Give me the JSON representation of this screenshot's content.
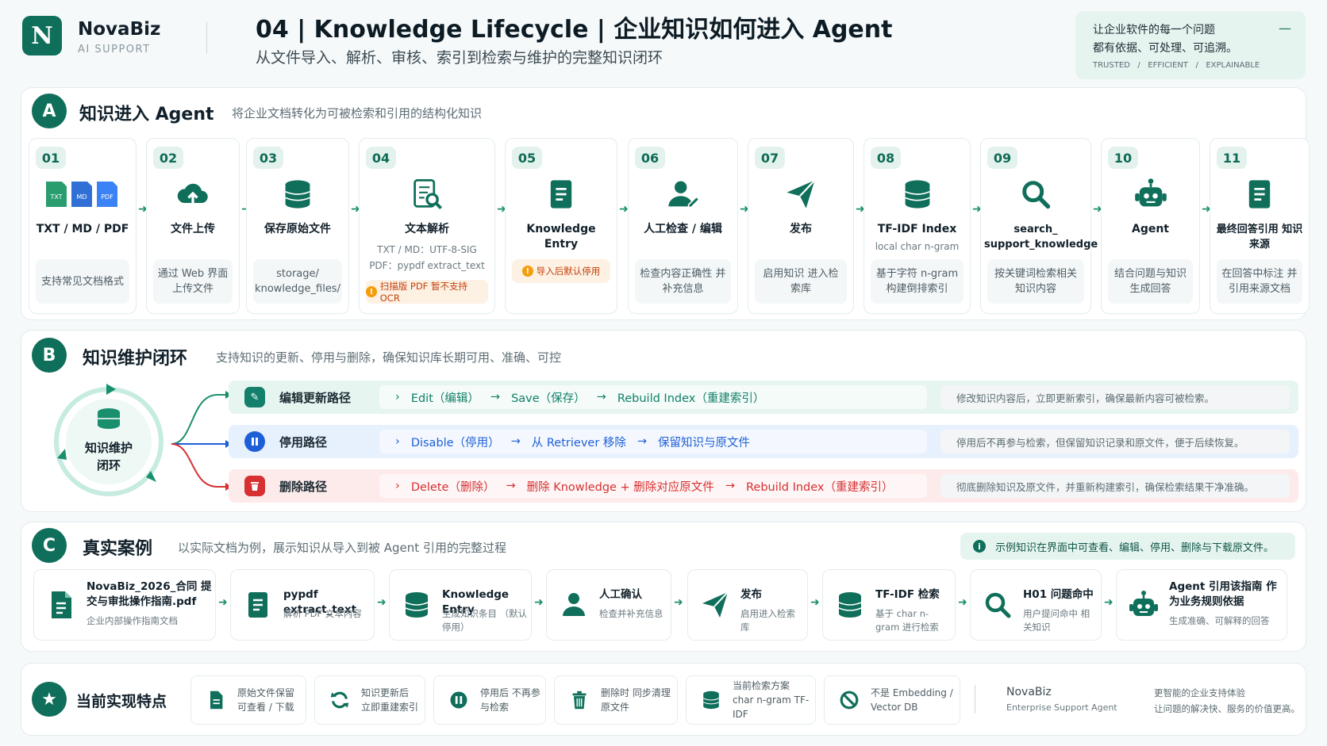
{
  "brand": {
    "logo_letter": "N",
    "name": "NovaBiz",
    "tag": "AI SUPPORT"
  },
  "header": {
    "title": "04 | Knowledge Lifecycle | 企业知识如何进入 Agent",
    "subtitle": "从文件导入、解析、审核、索引到检索与维护的完整知识闭环"
  },
  "motto": {
    "line1": "让企业软件的每一个问题",
    "line2": "都有依据、可处理、可追溯。",
    "tags": "TRUSTED   /   EFFICIENT   /   EXPLAINABLE",
    "dash": "—"
  },
  "sectionA": {
    "letter": "A",
    "title": "知识进入 Agent",
    "subtitle": "将企业文档转化为可被检索和引用的结构化知识",
    "steps": [
      {
        "num": "01",
        "title": "TXT / MD / PDF",
        "sub": "",
        "desc": "支持常见文档格式",
        "icon": "file-types-icon"
      },
      {
        "num": "02",
        "title": "文件上传",
        "sub": "",
        "desc": "通过 Web 界面上传文件",
        "icon": "cloud-upload-icon"
      },
      {
        "num": "03",
        "title": "保存原始文件",
        "sub": "",
        "desc": "storage/ knowledge_files/",
        "icon": "database-icon"
      },
      {
        "num": "04",
        "title": "文本解析",
        "sub": "TXT / MD：UTF-8-SIG",
        "sub2": "PDF：pypdf extract_text",
        "warn": "扫描版 PDF 暂不支持 OCR",
        "icon": "document-search-icon"
      },
      {
        "num": "05",
        "title": "Knowledge Entry",
        "sub": "",
        "warn": "导入后默认停用",
        "icon": "document-icon"
      },
      {
        "num": "06",
        "title": "人工检查 / 编辑",
        "sub": "",
        "desc": "检查内容正确性 并补充信息",
        "icon": "user-edit-icon"
      },
      {
        "num": "07",
        "title": "发布",
        "sub": "",
        "desc": "启用知识 进入检索库",
        "icon": "paper-plane-icon"
      },
      {
        "num": "08",
        "title": "TF-IDF Index",
        "sub": "local char n-gram",
        "desc": "基于字符 n-gram 构建倒排索引",
        "icon": "database-icon"
      },
      {
        "num": "09",
        "title": "search_ support_knowledge",
        "sub": "",
        "desc": "按关键词检索相关 知识内容",
        "icon": "search-icon"
      },
      {
        "num": "10",
        "title": "Agent",
        "sub": "",
        "desc": "结合问题与知识 生成回答",
        "icon": "robot-icon"
      },
      {
        "num": "11",
        "title": "最终回答引用 知识来源",
        "sub": "",
        "desc": "在回答中标注 并引用来源文档",
        "icon": "document-icon"
      }
    ]
  },
  "sectionB": {
    "letter": "B",
    "title": "知识维护闭环",
    "subtitle": "支持知识的更新、停用与删除，确保知识库长期可用、准确、可控",
    "cycle_label": "知识维护 闭环",
    "rows": [
      {
        "label": "编辑更新路径",
        "flow": [
          "Edit（编辑）",
          "Save（保存）",
          "Rebuild Index（重建索引）"
        ],
        "note": "修改知识内容后，立即更新索引，确保最新内容可被检索。",
        "color": "#12806a",
        "bg": "#e6f5f0",
        "icon": "edit-icon"
      },
      {
        "label": "停用路径",
        "flow": [
          "Disable（停用）",
          "从 Retriever 移除",
          "保留知识与原文件"
        ],
        "note": "停用后不再参与检索，但保留知识记录和原文件，便于后续恢复。",
        "color": "#1d5fd6",
        "bg": "#e7f0fd",
        "icon": "pause-icon"
      },
      {
        "label": "删除路径",
        "flow": [
          "Delete（删除）",
          "删除 Knowledge + 删除对应原文件",
          "Rebuild Index（重建索引）"
        ],
        "note": "彻底删除知识及原文件，并重新构建索引，确保检索结果干净准确。",
        "color": "#d63031",
        "bg": "#fdeaea",
        "icon": "trash-icon"
      }
    ]
  },
  "sectionC": {
    "letter": "C",
    "title": "真实案例",
    "subtitle": "以实际文档为例，展示知识从导入到被 Agent 引用的完整过程",
    "notice": "示例知识在界面中可查看、编辑、停用、删除与下载原文件。",
    "cases": [
      {
        "title": "NovaBiz_2026_合同 提交与审批操作指南.pdf",
        "sub": "企业内部操作指南文档",
        "icon": "pdf-file-icon"
      },
      {
        "title": "pypdf extract_text",
        "sub": "解析 PDF 文本内容",
        "icon": "document-icon"
      },
      {
        "title": "Knowledge Entry",
        "sub": "生成知识条目 （默认停用）",
        "icon": "database-icon"
      },
      {
        "title": "人工确认",
        "sub": "检查并补充信息",
        "icon": "user-icon"
      },
      {
        "title": "发布",
        "sub": "启用进入检索库",
        "icon": "paper-plane-icon"
      },
      {
        "title": "TF-IDF 检索",
        "sub": "基于 char n-gram 进行检索",
        "icon": "database-icon"
      },
      {
        "title": "H01 问题命中",
        "sub": "用户提问命中 相关知识",
        "icon": "search-icon"
      },
      {
        "title": "Agent 引用该指南 作为业务规则依据",
        "sub": "生成准确、可解释的回答",
        "icon": "robot-icon"
      }
    ]
  },
  "features": {
    "title": "当前实现特点",
    "items": [
      {
        "text": "原始文件保留 可查看 / 下载",
        "icon": "file-icon"
      },
      {
        "text": "知识更新后 立即重建索引",
        "icon": "refresh-icon"
      },
      {
        "text": "停用后 不再参与检索",
        "icon": "pause-icon"
      },
      {
        "text": "删除时 同步清理原文件",
        "icon": "trash-icon"
      },
      {
        "text": "当前检索方案 char n-gram TF-IDF",
        "icon": "database-icon"
      },
      {
        "text": "不是 Embedding / Vector DB",
        "icon": "ban-icon"
      }
    ],
    "brand_line1": "NovaBiz",
    "brand_line2": "Enterprise Support Agent",
    "slogan1": "更智能的企业支持体验",
    "slogan2": "让问题的解决快、服务的价值更高。"
  },
  "colors": {
    "primary": "#0f6f5a",
    "blue": "#1d5fd6",
    "red": "#d63031",
    "orange": "#f59e0b"
  }
}
